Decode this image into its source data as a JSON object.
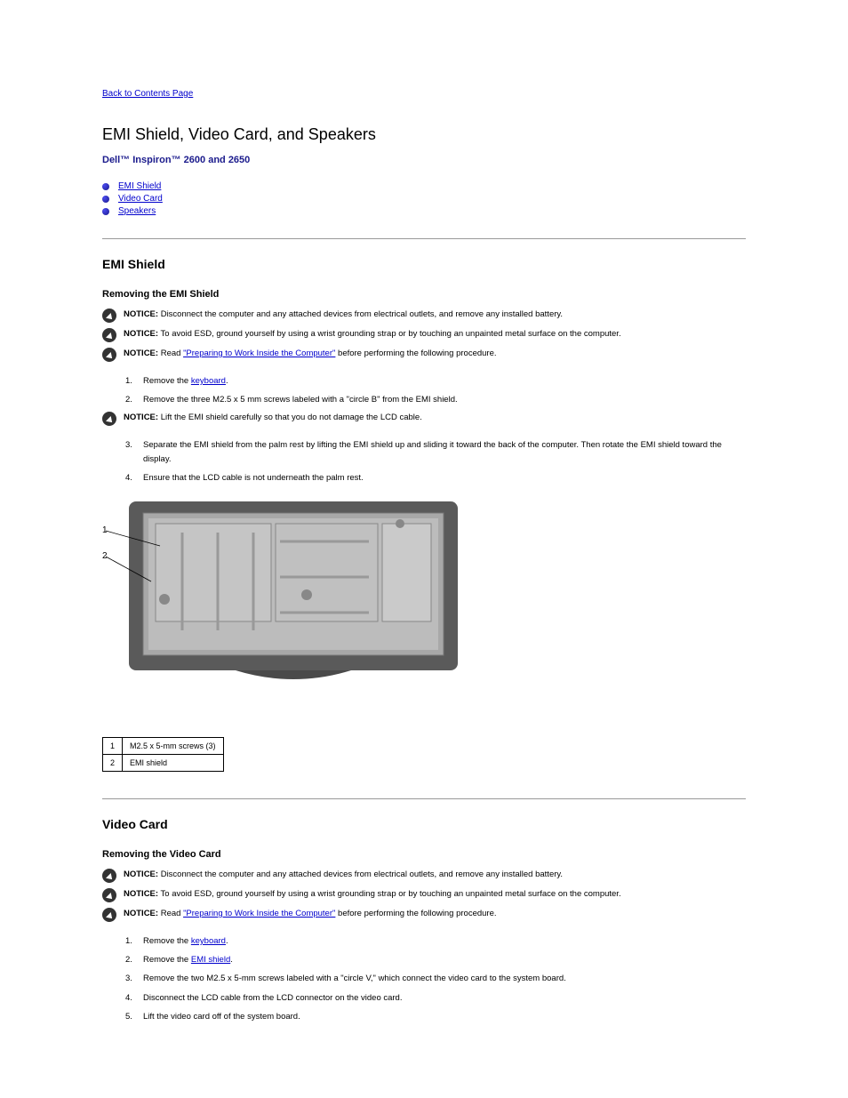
{
  "backLink": "Back to Contents Page",
  "pageTitle": "EMI Shield, Video Card, and Speakers",
  "subtitle": "Dell™ Inspiron™ 2600 and 2650",
  "toc": [
    {
      "label": "EMI Shield",
      "href": "#emi"
    },
    {
      "label": "Video Card",
      "href": "#video"
    },
    {
      "label": "Speakers",
      "href": "#speakers"
    }
  ],
  "emi": {
    "title": "EMI Shield",
    "removeTitle": "Removing the EMI Shield",
    "notice1": {
      "bold": "NOTICE:",
      "text": " Disconnect the computer and any attached devices from electrical outlets, and remove any installed battery."
    },
    "notice2": {
      "bold": "NOTICE:",
      "text": " To avoid ESD, ground yourself by using a wrist grounding strap or by touching an unpainted metal surface on the computer."
    },
    "notice3": {
      "bold": "NOTICE:",
      "textBefore": " Read ",
      "linkText": "\"Preparing to Work Inside the Computer\"",
      "textAfter": " before performing the following procedure."
    },
    "step1": {
      "num": "1.",
      "textBefore": "Remove the ",
      "linkText": "keyboard",
      "textAfter": "."
    },
    "step2": {
      "num": "2.",
      "text": "Remove the three M2.5 x 5 mm screws labeled with a \"circle B\" from the EMI shield."
    },
    "notice4": {
      "bold": "NOTICE:",
      "text": " Lift the EMI shield carefully so that you do not damage the LCD cable."
    },
    "step3": {
      "num": "3.",
      "text": "Separate the EMI shield from the palm rest by lifting the EMI shield up and sliding it toward the back of the computer. Then rotate the EMI shield toward the display."
    },
    "step4": {
      "num": "4.",
      "text": "Ensure that the LCD cable is not underneath the palm rest."
    },
    "legend": [
      {
        "num": "1",
        "label": "M2.5 x 5-mm screws (3)"
      },
      {
        "num": "2",
        "label": "EMI shield"
      }
    ]
  },
  "video": {
    "title": "Video Card",
    "removeTitle": "Removing the Video Card",
    "notice1": {
      "bold": "NOTICE:",
      "text": " Disconnect the computer and any attached devices from electrical outlets, and remove any installed battery."
    },
    "notice2": {
      "bold": "NOTICE:",
      "text": " To avoid ESD, ground yourself by using a wrist grounding strap or by touching an unpainted metal surface on the computer."
    },
    "notice3": {
      "bold": "NOTICE:",
      "textBefore": " Read ",
      "linkText": "\"Preparing to Work Inside the Computer\"",
      "textAfter": " before performing the following procedure."
    },
    "step1": {
      "num": "1.",
      "textBefore": "Remove the ",
      "linkText": "keyboard",
      "textAfter": "."
    },
    "step2": {
      "num": "2.",
      "textBefore": "Remove the ",
      "linkText": "EMI shield",
      "textAfter": "."
    },
    "step3": {
      "num": "3.",
      "text": "Remove the two M2.5 x 5-mm screws labeled with a \"circle V,\" which connect the video card to the system board."
    },
    "step4": {
      "num": "4.",
      "text": "Disconnect the LCD cable from the LCD connector on the video card."
    },
    "step5": {
      "num": "5.",
      "text": "Lift the video card off of the system board."
    }
  }
}
